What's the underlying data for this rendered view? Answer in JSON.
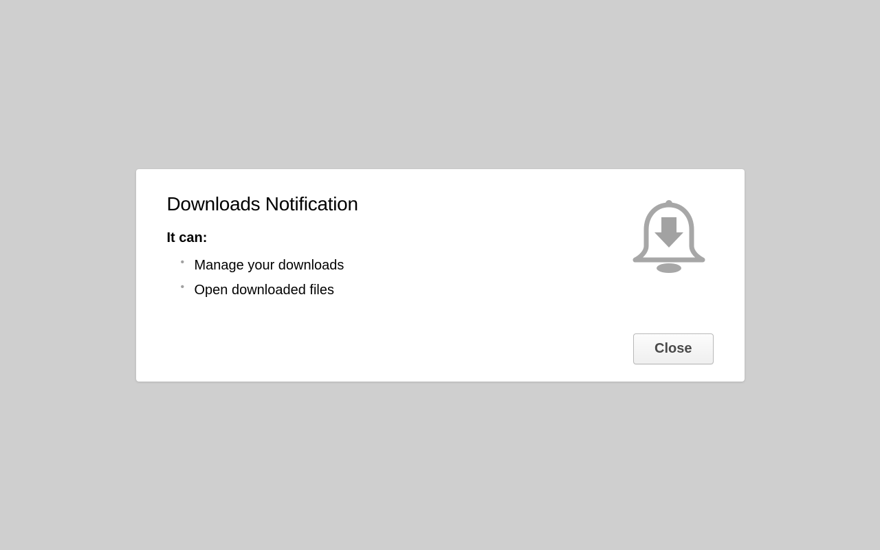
{
  "dialog": {
    "title": "Downloads Notification",
    "sub_heading": "It can:",
    "permissions": [
      "Manage your downloads",
      "Open downloaded files"
    ],
    "close_label": "Close",
    "icon": "bell-download-icon"
  }
}
